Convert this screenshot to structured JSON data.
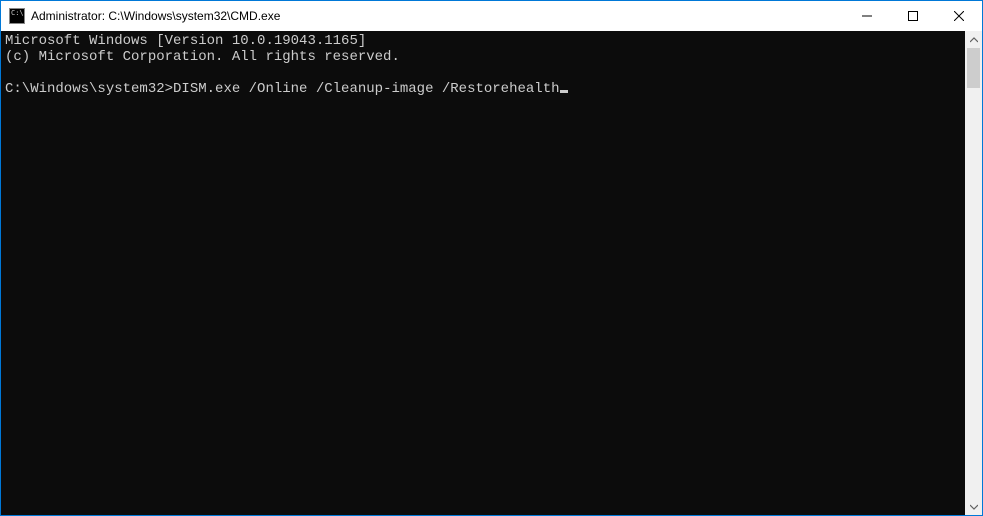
{
  "titlebar": {
    "title": "Administrator: C:\\Windows\\system32\\CMD.exe"
  },
  "terminal": {
    "line1": "Microsoft Windows [Version 10.0.19043.1165]",
    "line2": "(c) Microsoft Corporation. All rights reserved.",
    "blank": "",
    "prompt": "C:\\Windows\\system32>",
    "command": "DISM.exe /Online /Cleanup-image /Restorehealth"
  }
}
